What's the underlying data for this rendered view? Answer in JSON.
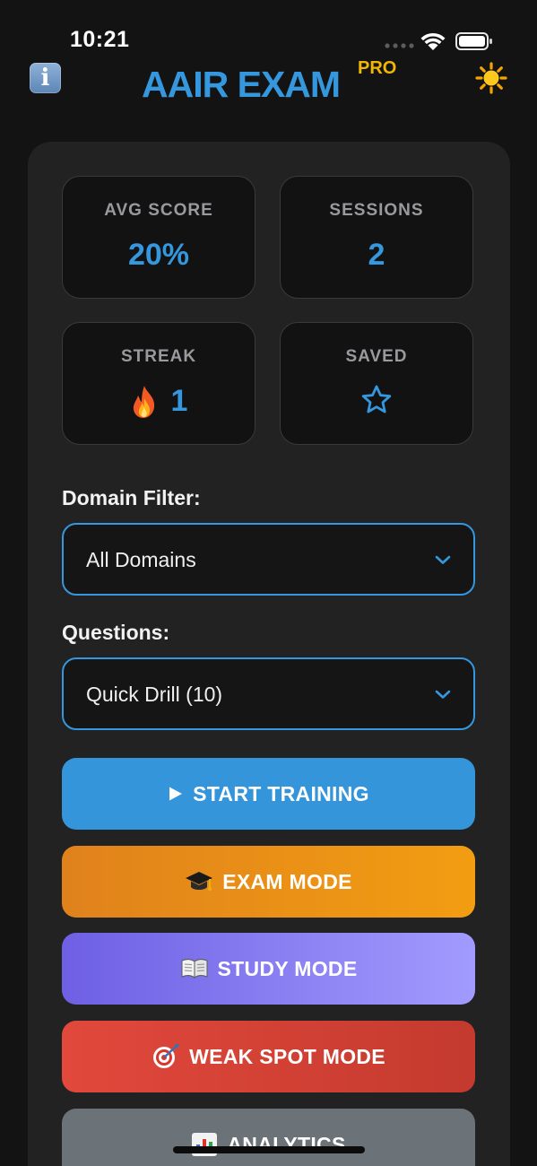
{
  "status_bar": {
    "time": "10:21"
  },
  "header": {
    "info_icon_glyph": "i",
    "title": "AAIR EXAM",
    "badge": "PRO",
    "theme_icon": "sun-icon"
  },
  "stats": [
    {
      "label": "AVG SCORE",
      "value": "20%"
    },
    {
      "label": "SESSIONS",
      "value": "2"
    },
    {
      "label": "STREAK",
      "value": "1",
      "icon": "fire-icon"
    },
    {
      "label": "SAVED",
      "icon": "star-outline-icon"
    }
  ],
  "domain_filter": {
    "label": "Domain Filter:",
    "selected": "All Domains"
  },
  "questions": {
    "label": "Questions:",
    "selected": "Quick Drill (10)"
  },
  "actions": {
    "start": {
      "label": "START TRAINING",
      "icon": "play-icon"
    },
    "exam": {
      "label": "EXAM MODE",
      "icon": "graduation-cap-icon"
    },
    "study": {
      "label": "STUDY MODE",
      "icon": "open-book-icon"
    },
    "weak": {
      "label": "WEAK SPOT MODE",
      "icon": "target-icon"
    },
    "analytics": {
      "label": "ANALYTICS",
      "icon": "bar-chart-icon"
    }
  },
  "colors": {
    "accent": "#3597dd",
    "pro": "#f2b705",
    "exam": "#f29d12",
    "study": "#a29bfe",
    "weak": "#e2483c",
    "analytics": "#6b7278"
  }
}
